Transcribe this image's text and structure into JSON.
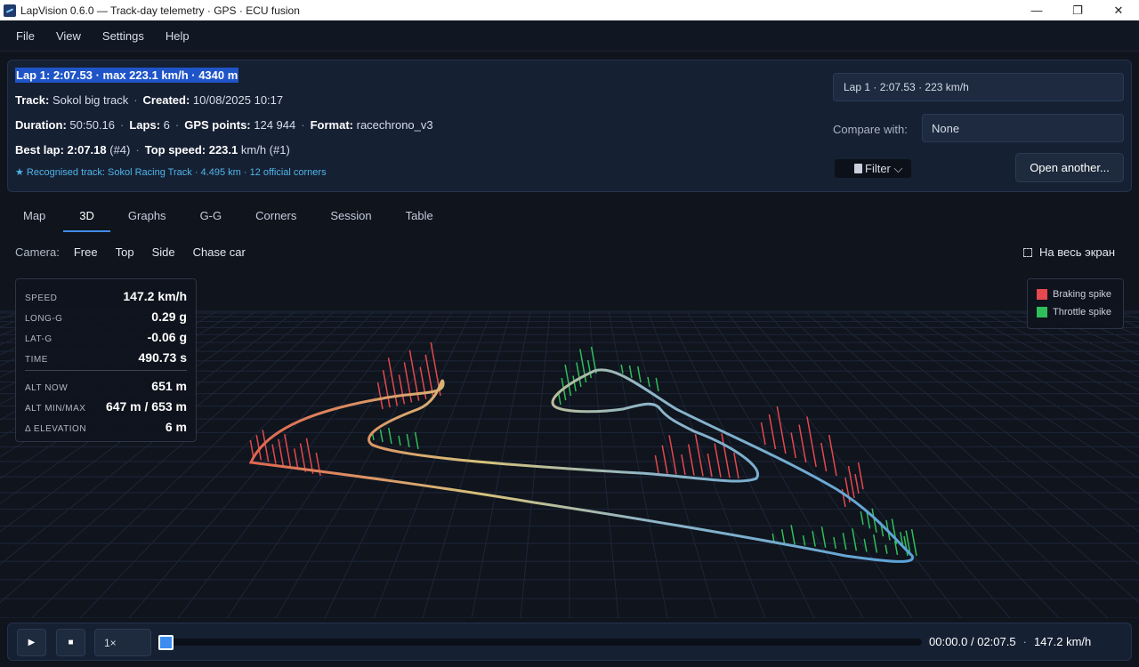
{
  "window": {
    "title": "LapVision 0.6.0 — Track-day telemetry · GPS · ECU fusion",
    "minimize": "—",
    "maximize": "❐",
    "close": "✕"
  },
  "menu": [
    "File",
    "View",
    "Settings",
    "Help"
  ],
  "session": {
    "headline": "Lap 1: 2:07.53 · max 223.1 km/h · 4340 m",
    "track_label": "Track:",
    "track": "Sokol big track",
    "created_label": "Created:",
    "created": "10/08/2025 10:17",
    "duration_label": "Duration:",
    "duration": "50:50.16",
    "laps_label": "Laps:",
    "laps": "6",
    "gps_label": "GPS points:",
    "gps": "124 944",
    "format_label": "Format:",
    "format": "racechrono_v3",
    "best_label": "Best lap:",
    "best": "2:07.18",
    "best_num": "(#4)",
    "top_label": "Top speed:",
    "top": "223.1",
    "top_unit": "km/h (#1)",
    "sep": "·",
    "recognised": "★ Recognised track: Sokol Racing Track · 4.495 km · 12 official corners"
  },
  "controls": {
    "lap_select": "Lap 1  ·  2:07.53  ·  223 km/h",
    "compare_label": "Compare with:",
    "compare_value": "None",
    "filter": "Filter ⌵",
    "open_another": "Open another..."
  },
  "tabs": [
    "Map",
    "3D",
    "Graphs",
    "G-G",
    "Corners",
    "Session",
    "Table"
  ],
  "active_tab": "3D",
  "camera": {
    "label": "Camera:",
    "options": [
      "Free",
      "Top",
      "Side",
      "Chase car"
    ],
    "fullscreen": "На весь экран"
  },
  "stats": {
    "speed_label": "SPEED",
    "speed": "147.2 km/h",
    "longg_label": "LONG-G",
    "longg": "0.29 g",
    "latg_label": "LAT-G",
    "latg": "-0.06 g",
    "time_label": "TIME",
    "time": "490.73 s",
    "altnow_label": "ALT NOW",
    "altnow": "651 m",
    "altmm_label": "ALT MIN/MAX",
    "altmm": "647 m / 653 m",
    "delev_label": "Δ ELEVATION",
    "delev": "6 m"
  },
  "legend": {
    "braking": "Braking spike",
    "braking_color": "#e5484d",
    "throttle": "Throttle spike",
    "throttle_color": "#2fbf5a"
  },
  "playback": {
    "play_icon": "▶",
    "stop_icon": "■",
    "speed": "1×",
    "progress": 0.0,
    "time": "00:00.0 / 02:07.5",
    "sep": "·",
    "speed_readout": "147.2 km/h"
  }
}
